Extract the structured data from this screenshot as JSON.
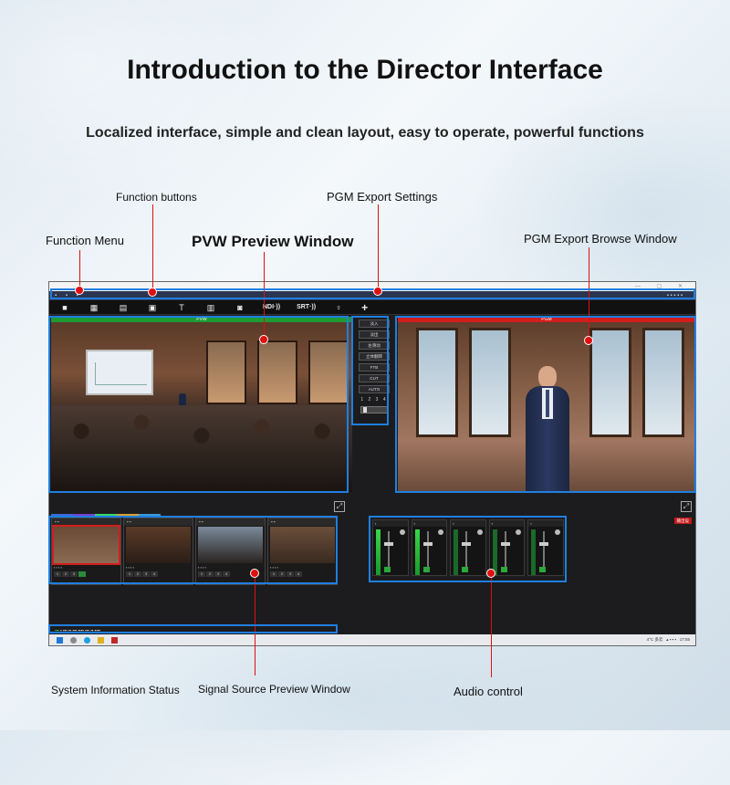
{
  "title": "Introduction to the Director Interface",
  "subtitle": "Localized interface, simple and clean layout, easy to operate, powerful functions",
  "callouts": {
    "function_buttons": "Function buttons",
    "pgm_export_settings": "PGM Export Settings",
    "function_menu": "Function Menu",
    "pvw_preview_window": "PVW Preview Window",
    "pgm_export_browse_window": "PGM Export Browse Window",
    "system_information_status": "System Information Status",
    "signal_source_preview_window": "Signal Source Preview Window",
    "audio_control": "Audio control"
  },
  "app": {
    "toolbar": {
      "ndi_label": "NDI·))",
      "srt_label": "SRT·))",
      "add_label": "+"
    },
    "pvw_bar": "PVW",
    "pgm_bar": "PGM",
    "transitions": {
      "buttons": [
        "淡入",
        "淡出",
        "左滑动",
        "立体翻转",
        "FTB",
        "CUT",
        "AUTO"
      ],
      "numbers": "1 2 3 4"
    },
    "taskbar": {
      "weather": "4°C 多云",
      "clock": "17:55"
    },
    "audio_red_tag": "输出设"
  }
}
